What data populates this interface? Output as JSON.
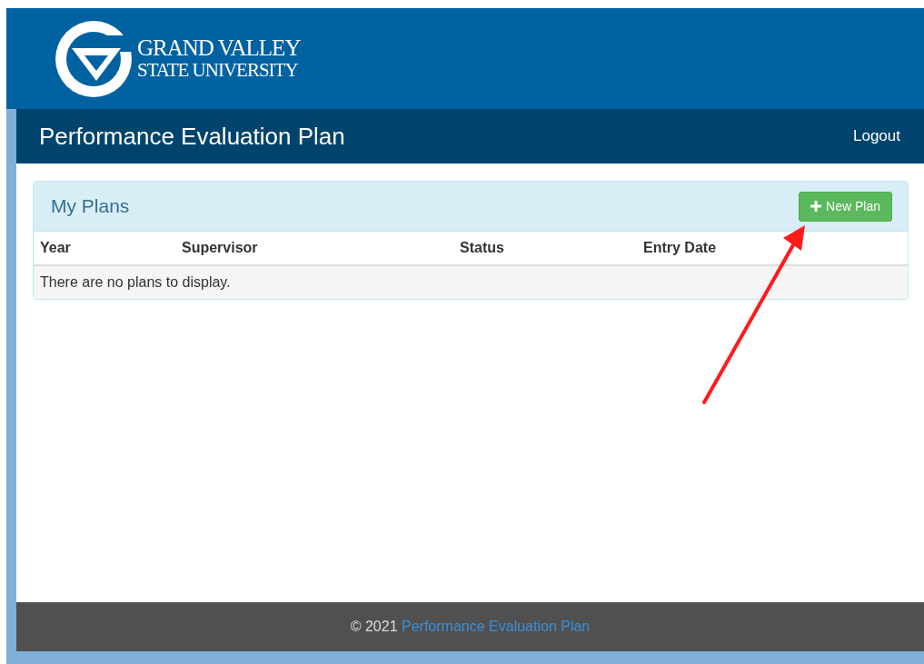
{
  "header": {
    "logo_line_1": "GRAND VALLEY",
    "logo_line_2": "STATE UNIVERSITY"
  },
  "navbar": {
    "title": "Performance Evaluation Plan",
    "logout": "Logout"
  },
  "panel": {
    "title": "My Plans",
    "new_button": "New Plan",
    "table": {
      "columns": [
        "Year",
        "Supervisor",
        "Status",
        "Entry Date"
      ],
      "empty_message": "There are no plans to display."
    }
  },
  "footer": {
    "copyright": "© 2021",
    "link": "Performance Evaluation Plan"
  }
}
